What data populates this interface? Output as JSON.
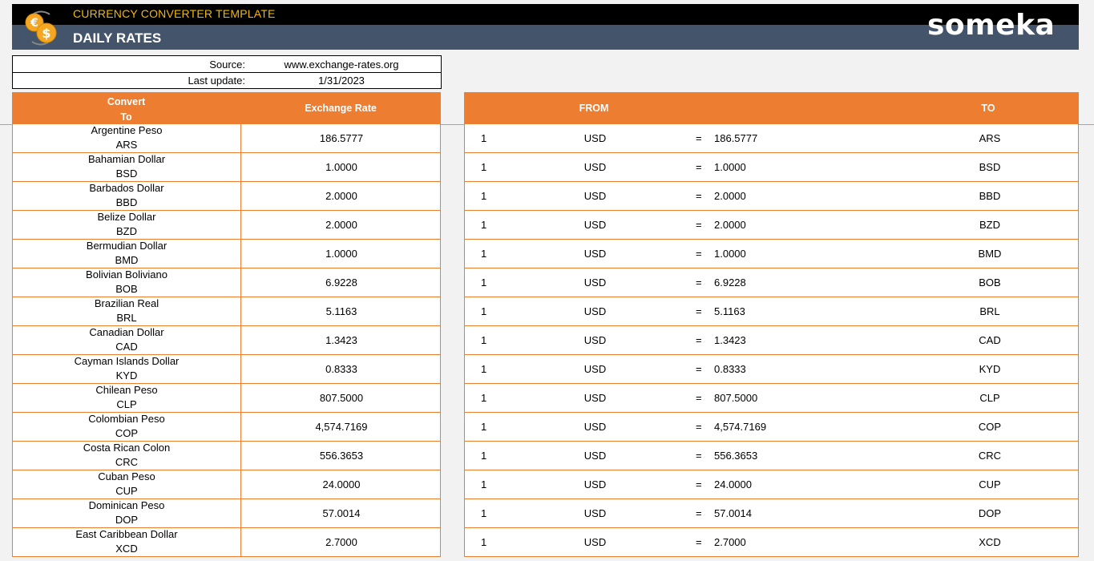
{
  "header": {
    "app_title": "CURRENCY CONVERTER TEMPLATE",
    "page_title": "DAILY RATES",
    "brand": "someka",
    "logo_icon": "currency-exchange-icon"
  },
  "info": {
    "source_label": "Source:",
    "source_value": "www.exchange-rates.org",
    "update_label": "Last update:",
    "update_value": "1/31/2023"
  },
  "rates_table": {
    "col_convert_line1": "Convert",
    "col_convert_line2": "To",
    "col_rate": "Exchange Rate",
    "rows": [
      {
        "name": "Argentine Peso",
        "code": "ARS",
        "rate": "186.5777"
      },
      {
        "name": "Bahamian Dollar",
        "code": "BSD",
        "rate": "1.0000"
      },
      {
        "name": "Barbados Dollar",
        "code": "BBD",
        "rate": "2.0000"
      },
      {
        "name": "Belize Dollar",
        "code": "BZD",
        "rate": "2.0000"
      },
      {
        "name": "Bermudian Dollar",
        "code": "BMD",
        "rate": "1.0000"
      },
      {
        "name": "Bolivian Boliviano",
        "code": "BOB",
        "rate": "6.9228"
      },
      {
        "name": "Brazilian Real",
        "code": "BRL",
        "rate": "5.1163"
      },
      {
        "name": "Canadian Dollar",
        "code": "CAD",
        "rate": "1.3423"
      },
      {
        "name": "Cayman Islands Dollar",
        "code": "KYD",
        "rate": "0.8333"
      },
      {
        "name": "Chilean Peso",
        "code": "CLP",
        "rate": "807.5000"
      },
      {
        "name": "Colombian Peso",
        "code": "COP",
        "rate": "4,574.7169"
      },
      {
        "name": "Costa Rican Colon",
        "code": "CRC",
        "rate": "556.3653"
      },
      {
        "name": "Cuban Peso",
        "code": "CUP",
        "rate": "24.0000"
      },
      {
        "name": "Dominican Peso",
        "code": "DOP",
        "rate": "57.0014"
      },
      {
        "name": "East Caribbean Dollar",
        "code": "XCD",
        "rate": "2.7000"
      }
    ]
  },
  "conversion_table": {
    "col_from": "FROM",
    "col_to": "TO",
    "amount": "1",
    "from_code": "USD",
    "equals": "="
  },
  "colors": {
    "accent": "#ed7d31",
    "header_dark": "#44546a",
    "header_black": "#000000",
    "title_gold": "#f5b800"
  }
}
